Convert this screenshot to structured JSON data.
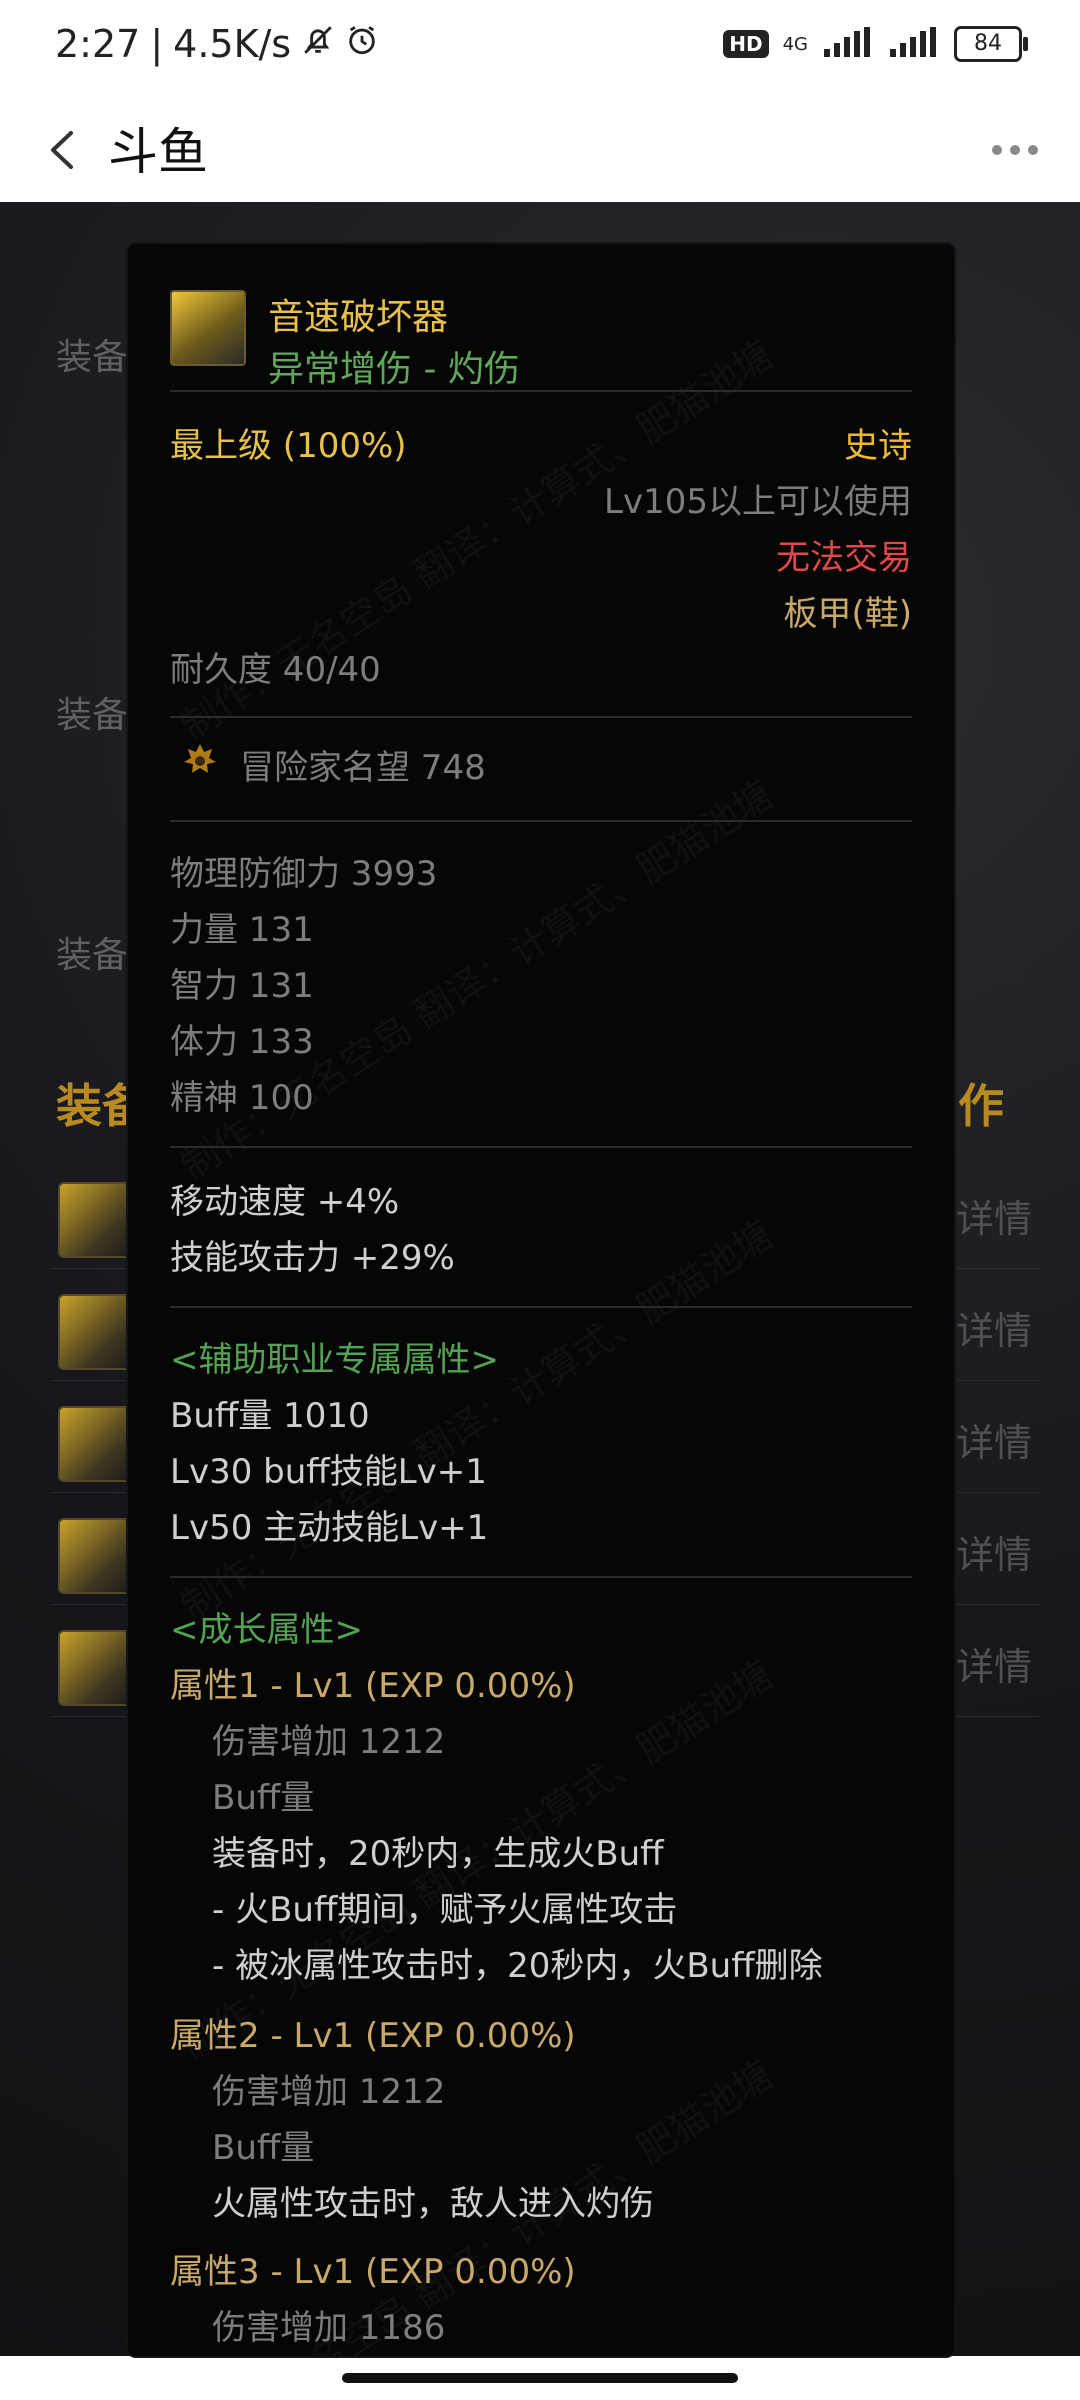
{
  "status_bar": {
    "time": "2:27",
    "separator": "|",
    "net_speed": "4.5K/s",
    "hd": "HD",
    "network": "4G",
    "battery": "84"
  },
  "app_bar": {
    "title": "斗鱼"
  },
  "background": {
    "row_label": "装备",
    "section_title": "装备",
    "section_title_right": "作",
    "detail_label": "详情"
  },
  "item": {
    "name": "音速破坏器",
    "subtitle": "异常增伤 - 灼伤",
    "grade": "最上级 (100%)",
    "rarity": "史诗",
    "level_req": "Lv105以上可以使用",
    "trade": "无法交易",
    "type": "板甲(鞋)",
    "durability": "耐久度 40/40",
    "fame": "冒险家名望 748",
    "base_stats": [
      "物理防御力  3993",
      "力量  131",
      "智力  131",
      "体力  133",
      "精神  100"
    ],
    "bonus_stats": [
      "移动速度   +4%",
      "技能攻击力   +29%"
    ],
    "support_header": "<辅助职业专属属性>",
    "support_stats": [
      "Buff量   1010",
      "Lv30 buff技能Lv+1",
      "Lv50 主动技能Lv+1"
    ],
    "growth_header": "<成长属性>",
    "growth": [
      {
        "title": "属性1 - Lv1 (EXP 0.00%)",
        "damage": "伤害增加   1212",
        "buff": "Buff量",
        "effects": [
          "装备时，20秒内，生成火Buff",
          "- 火Buff期间，赋予火属性攻击",
          "- 被冰属性攻击时，20秒内，火Buff删除"
        ]
      },
      {
        "title": "属性2 - Lv1 (EXP 0.00%)",
        "damage": "伤害增加   1212",
        "buff": "Buff量",
        "effects": [
          "火属性攻击时，敌人进入灼伤"
        ]
      },
      {
        "title": "属性3 - Lv1 (EXP 0.00%)",
        "damage": "伤害增加   1186"
      }
    ],
    "watermark": "制作：无名空岛 翻译：计算式、肥猫池塘"
  },
  "icons": {
    "back": "chevron-left-icon",
    "more": "more-horizontal-icon",
    "mute": "bell-off-icon",
    "alarm": "alarm-icon",
    "signal": "signal-icon",
    "battery": "battery-icon",
    "fame": "crown-icon",
    "item": "boots-icon"
  },
  "colors": {
    "item_name": "#e8c14b",
    "subtitle_green": "#52a352",
    "rarity_epic": "#f0b92c",
    "untradable_red": "#e24848",
    "section_gold": "#b98a22"
  }
}
